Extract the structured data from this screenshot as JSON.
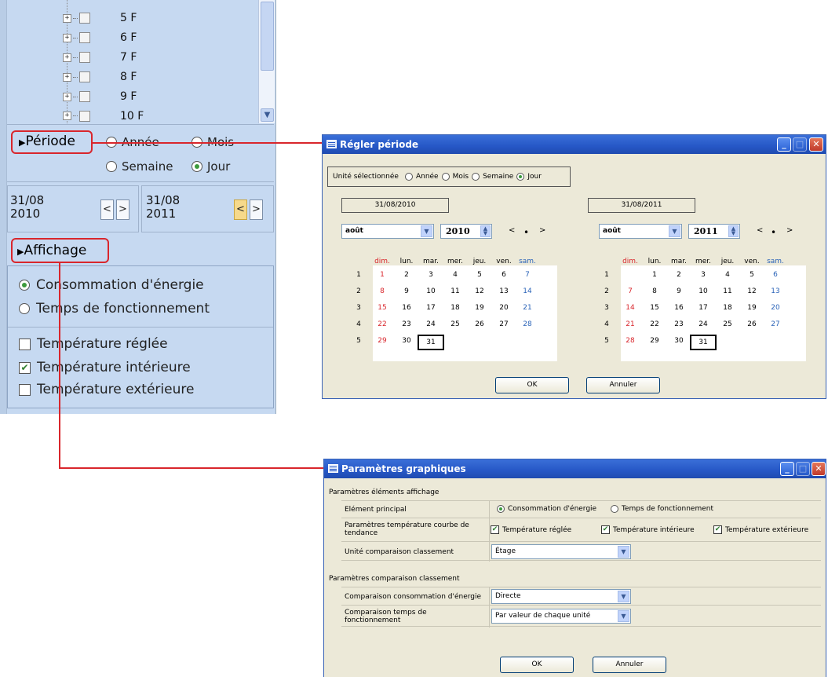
{
  "tree": {
    "items": [
      "5 F",
      "6 F",
      "7 F",
      "8 F",
      "9 F",
      "10 F"
    ]
  },
  "left_panel": {
    "periode_label": "Période",
    "periode_options": [
      "Année",
      "Mois",
      "Semaine",
      "Jour"
    ],
    "periode_selected": "Jour",
    "start_date_line1": "31/08",
    "start_date_line2": "2010",
    "end_date_line1": "31/08",
    "end_date_line2": "2011",
    "prev": "<",
    "next": ">",
    "affichage_label": "Affichage",
    "radio1": "Consommation d'énergie",
    "radio2": "Temps de fonctionnement",
    "check1": "Température réglée",
    "check2": "Température intérieure",
    "check3": "Température extérieure",
    "check2_checked": true
  },
  "dialog1": {
    "title": "Régler période",
    "unit_label": "Unité sélectionnée",
    "unit_options": [
      "Année",
      "Mois",
      "Semaine",
      "Jour"
    ],
    "unit_selected": "Jour",
    "left": {
      "date": "31/08/2010",
      "month": "août",
      "year": "2010"
    },
    "right": {
      "date": "31/08/2011",
      "month": "août",
      "year": "2011"
    },
    "nav_prev": "<",
    "nav_dot": "•",
    "nav_next": ">",
    "weekdays": [
      "dim.",
      "lun.",
      "mar.",
      "mer.",
      "jeu.",
      "ven.",
      "sam."
    ],
    "weeks": [
      "1",
      "2",
      "3",
      "4",
      "5"
    ],
    "left_cal": [
      [
        "",
        "1",
        "2",
        "3",
        "4",
        "5",
        "6",
        "7"
      ],
      [
        "",
        "8",
        "9",
        "10",
        "11",
        "12",
        "13",
        "14"
      ],
      [
        "",
        "15",
        "16",
        "17",
        "18",
        "19",
        "20",
        "21"
      ],
      [
        "",
        "22",
        "23",
        "24",
        "25",
        "26",
        "27",
        "28"
      ],
      [
        "",
        "29",
        "30",
        "31",
        "",
        "",
        "",
        ""
      ]
    ],
    "right_cal": [
      [
        "",
        "",
        "1",
        "2",
        "3",
        "4",
        "5",
        "6"
      ],
      [
        "",
        "7",
        "8",
        "9",
        "10",
        "11",
        "12",
        "13"
      ],
      [
        "",
        "14",
        "15",
        "16",
        "17",
        "18",
        "19",
        "20"
      ],
      [
        "",
        "21",
        "22",
        "23",
        "24",
        "25",
        "26",
        "27"
      ],
      [
        "",
        "28",
        "29",
        "30",
        "31",
        "",
        "",
        ""
      ]
    ],
    "ok": "OK",
    "cancel": "Annuler"
  },
  "dialog2": {
    "title": "Paramètres graphiques",
    "section1": "Paramètres éléments affichage",
    "row1_label": "Elément principal",
    "row1_opt1": "Consommation d'énergie",
    "row1_opt2": "Temps de fonctionnement",
    "row2_label_l1": "Paramètres température courbe de",
    "row2_label_l2": "tendance",
    "row2_opt1": "Température réglée",
    "row2_opt2": "Température intérieure",
    "row2_opt3": "Température extérieure",
    "row3_label": "Unité comparaison classement",
    "row3_value": "Étage",
    "section2": "Paramètres comparaison classement",
    "row4_label": "Comparaison consommation d'énergie",
    "row4_value": "Directe",
    "row5_label_l1": "Comparaison temps de",
    "row5_label_l2": "fonctionnement",
    "row5_value": "Par valeur de chaque unité",
    "ok": "OK",
    "cancel": "Annuler"
  },
  "colors": {
    "highlight": "#d9262c",
    "panel": "#c6d9f1",
    "titlebar": "#2657c6"
  }
}
